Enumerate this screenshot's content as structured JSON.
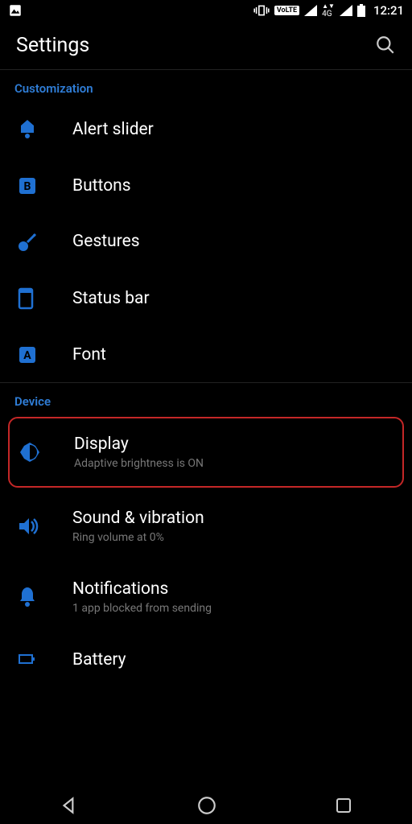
{
  "status_bar": {
    "time": "12:21",
    "network_label": "4G",
    "volte": "VoLTE"
  },
  "app_bar": {
    "title": "Settings"
  },
  "sections": {
    "customization": {
      "header": "Customization",
      "items": [
        {
          "label": "Alert slider"
        },
        {
          "label": "Buttons"
        },
        {
          "label": "Gestures"
        },
        {
          "label": "Status bar"
        },
        {
          "label": "Font"
        }
      ]
    },
    "device": {
      "header": "Device",
      "items": [
        {
          "label": "Display",
          "subtitle": "Adaptive brightness is ON"
        },
        {
          "label": "Sound & vibration",
          "subtitle": "Ring volume at 0%"
        },
        {
          "label": "Notifications",
          "subtitle": "1 app blocked from sending"
        },
        {
          "label": "Battery"
        }
      ]
    }
  },
  "colors": {
    "accent": "#1f70d2",
    "highlight": "#c42727"
  }
}
